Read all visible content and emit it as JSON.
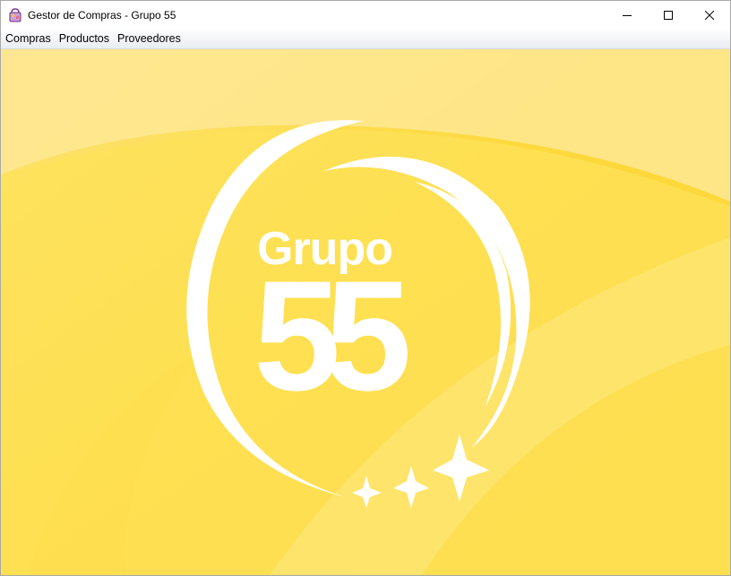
{
  "window": {
    "title": "Gestor de Compras - Grupo 55"
  },
  "menu": {
    "items": [
      {
        "label": "Compras"
      },
      {
        "label": "Productos"
      },
      {
        "label": "Proveedores"
      }
    ]
  },
  "logo": {
    "word": "Grupo",
    "number": "55"
  },
  "colors": {
    "background": "#fdd93c",
    "logo": "#ffffff"
  },
  "icons": {
    "app": "shopping-bag-icon",
    "minimize": "minimize-icon",
    "maximize": "maximize-icon",
    "close": "close-icon"
  }
}
